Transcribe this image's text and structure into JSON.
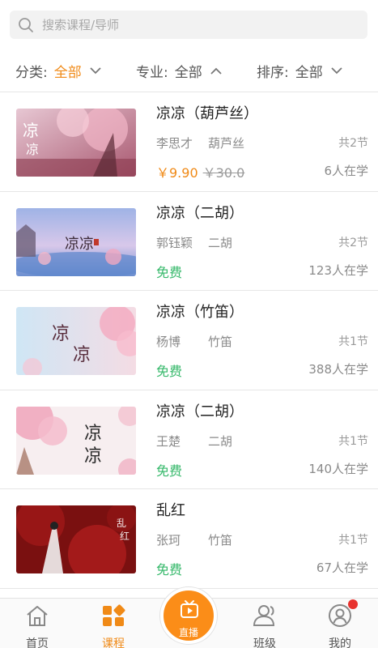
{
  "search": {
    "placeholder": "搜索课程/导师"
  },
  "filters": [
    {
      "label": "分类:",
      "value": "全部",
      "state": "collapsed"
    },
    {
      "label": "专业:",
      "value": "全部",
      "state": "expanded"
    },
    {
      "label": "排序:",
      "value": "全部",
      "state": "collapsed"
    }
  ],
  "courses": [
    {
      "title": "凉凉（葫芦丝）",
      "teacher": "李思才",
      "major": "葫芦丝",
      "sessions": "共2节",
      "price": "￥9.90",
      "original_price": "￥30.0",
      "learners": "6人在学"
    },
    {
      "title": "凉凉（二胡）",
      "teacher": "郭钰颖",
      "major": "二胡",
      "sessions": "共2节",
      "price": "免费",
      "learners": "123人在学"
    },
    {
      "title": "凉凉（竹笛）",
      "teacher": "杨博",
      "major": "竹笛",
      "sessions": "共1节",
      "price": "免费",
      "learners": "388人在学"
    },
    {
      "title": "凉凉（二胡）",
      "teacher": "王楚",
      "major": "二胡",
      "sessions": "共1节",
      "price": "免费",
      "learners": "140人在学"
    },
    {
      "title": "乱红",
      "teacher": "张珂",
      "major": "竹笛",
      "sessions": "共1节",
      "price": "免费",
      "learners": "67人在学"
    }
  ],
  "nav": {
    "home": "首页",
    "courses": "课程",
    "live": "直播",
    "classes": "班级",
    "mine": "我的",
    "active": "courses",
    "accent_color": "#f08a17"
  }
}
